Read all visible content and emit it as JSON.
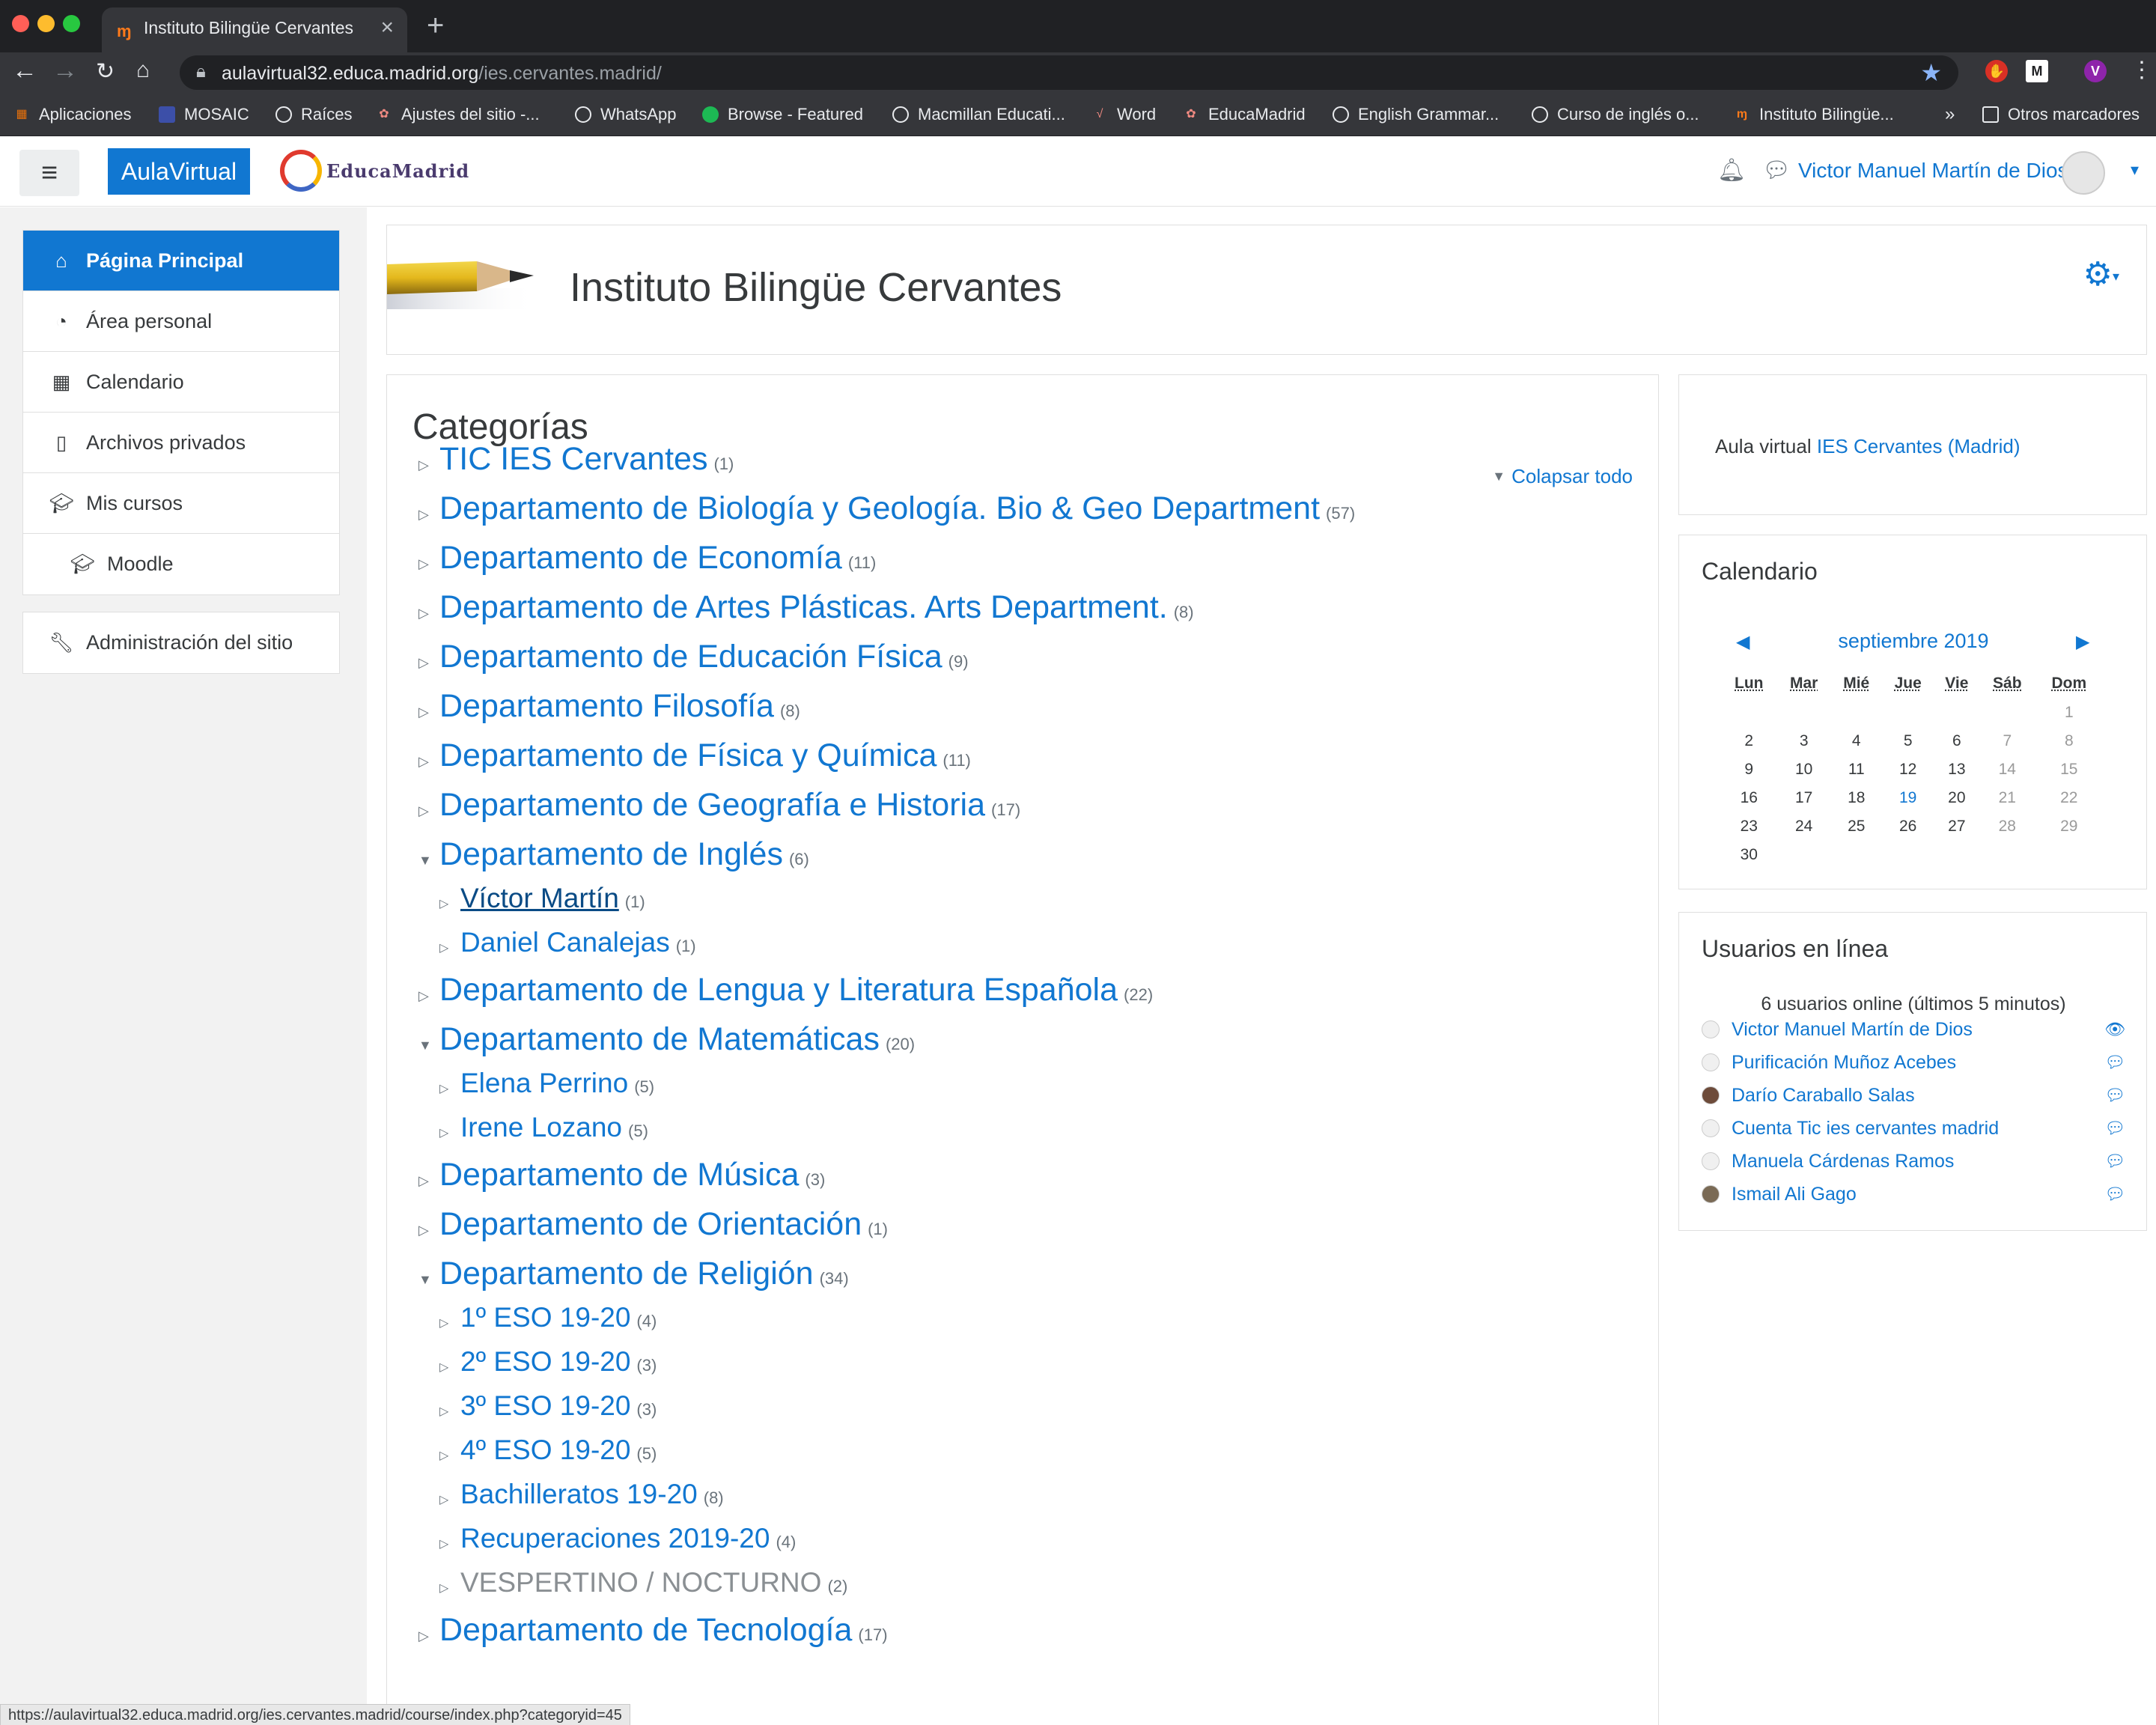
{
  "browser": {
    "tab_title": "Instituto Bilingüe Cervantes",
    "new_tab": "+",
    "url_host": "aulavirtual32.educa.madrid.org",
    "url_path": "/ies.cervantes.madrid/",
    "profile_initial": "V",
    "bookmarks": [
      "Aplicaciones",
      "MOSAIC",
      "Raíces",
      "Ajustes del sitio -...",
      "WhatsApp",
      "Browse - Featured",
      "Macmillan Educati...",
      "Word",
      "EducaMadrid",
      "English Grammar...",
      "Curso de inglés o...",
      "Instituto Bilingüe..."
    ],
    "bookmarks_more": "»",
    "other_bookmarks": "Otros marcadores",
    "status_url": "https://aulavirtual32.educa.madrid.org/ies.cervantes.madrid/course/index.php?categoryid=45"
  },
  "navbar": {
    "brand": "AulaVirtual",
    "logo_text": "EducaMadrid",
    "user_name": "Victor Manuel Martín de Dios"
  },
  "drawer": {
    "items": [
      {
        "label": "Página Principal",
        "icon": "home-icon"
      },
      {
        "label": "Área personal",
        "icon": "dashboard-icon"
      },
      {
        "label": "Calendario",
        "icon": "calendar-icon"
      },
      {
        "label": "Archivos privados",
        "icon": "file-icon"
      },
      {
        "label": "Mis cursos",
        "icon": "graduation-cap-icon"
      },
      {
        "label": "Moodle",
        "icon": "graduation-cap-icon"
      }
    ],
    "admin": {
      "label": "Administración del sitio",
      "icon": "wrench-icon"
    }
  },
  "header": {
    "title": "Instituto Bilingüe Cervantes"
  },
  "categories": {
    "heading": "Categorías",
    "collapse_all": "Colapsar todo",
    "rows": [
      {
        "name": "TIC IES Cervantes",
        "count": "(1)",
        "level": 1,
        "expanded": false
      },
      {
        "name": "Departamento de Biología y Geología. Bio & Geo Department",
        "count": "(57)",
        "level": 1,
        "expanded": false
      },
      {
        "name": "Departamento de Economía",
        "count": "(11)",
        "level": 1,
        "expanded": false
      },
      {
        "name": "Departamento de Artes Plásticas. Arts Department.",
        "count": "(8)",
        "level": 1,
        "expanded": false
      },
      {
        "name": "Departamento de Educación Física",
        "count": "(9)",
        "level": 1,
        "expanded": false
      },
      {
        "name": "Departamento Filosofía",
        "count": "(8)",
        "level": 1,
        "expanded": false
      },
      {
        "name": "Departamento de Física y Química",
        "count": "(11)",
        "level": 1,
        "expanded": false
      },
      {
        "name": "Departamento de Geografía e Historia",
        "count": "(17)",
        "level": 1,
        "expanded": false
      },
      {
        "name": "Departamento de Inglés",
        "count": "(6)",
        "level": 1,
        "expanded": true
      },
      {
        "name": "Víctor Martín",
        "count": "(1)",
        "level": 2,
        "expanded": false
      },
      {
        "name": "Daniel Canalejas",
        "count": "(1)",
        "level": 2,
        "expanded": false
      },
      {
        "name": "Departamento de Lengua y Literatura Española",
        "count": "(22)",
        "level": 1,
        "expanded": false
      },
      {
        "name": "Departamento de Matemáticas",
        "count": "(20)",
        "level": 1,
        "expanded": true
      },
      {
        "name": "Elena Perrino",
        "count": "(5)",
        "level": 2,
        "expanded": false
      },
      {
        "name": "Irene Lozano",
        "count": "(5)",
        "level": 2,
        "expanded": false
      },
      {
        "name": "Departamento de Música",
        "count": "(3)",
        "level": 1,
        "expanded": false
      },
      {
        "name": "Departamento de Orientación",
        "count": "(1)",
        "level": 1,
        "expanded": false
      },
      {
        "name": "Departamento de Religión",
        "count": "(34)",
        "level": 1,
        "expanded": true
      },
      {
        "name": "1º ESO 19-20",
        "count": "(4)",
        "level": 2,
        "expanded": false
      },
      {
        "name": "2º ESO 19-20",
        "count": "(3)",
        "level": 2,
        "expanded": false
      },
      {
        "name": "3º ESO 19-20",
        "count": "(3)",
        "level": 2,
        "expanded": false
      },
      {
        "name": "4º ESO 19-20",
        "count": "(5)",
        "level": 2,
        "expanded": false
      },
      {
        "name": "Bachilleratos 19-20",
        "count": "(8)",
        "level": 2,
        "expanded": false
      },
      {
        "name": "Recuperaciones 2019-20",
        "count": "(4)",
        "level": 2,
        "expanded": false
      },
      {
        "name": "VESPERTINO / NOCTURNO",
        "count": "(2)",
        "level": 2,
        "expanded": false,
        "hidden": true
      },
      {
        "name": "Departamento de Tecnología",
        "count": "(17)",
        "level": 1,
        "expanded": false
      }
    ]
  },
  "aula_block": {
    "prefix": "Aula virtual",
    "link": "IES Cervantes (Madrid)"
  },
  "calendar": {
    "title": "Calendario",
    "month": "septiembre 2019",
    "prev": "◀",
    "next": "▶",
    "weekdays": [
      "Lun",
      "Mar",
      "Mié",
      "Jue",
      "Vie",
      "Sáb",
      "Dom"
    ],
    "weeks": [
      [
        "",
        "",
        "",
        "",
        "",
        "",
        "1"
      ],
      [
        "2",
        "3",
        "4",
        "5",
        "6",
        "7",
        "8"
      ],
      [
        "9",
        "10",
        "11",
        "12",
        "13",
        "14",
        "15"
      ],
      [
        "16",
        "17",
        "18",
        "19",
        "20",
        "21",
        "22"
      ],
      [
        "23",
        "24",
        "25",
        "26",
        "27",
        "28",
        "29"
      ],
      [
        "30",
        "",
        "",
        "",
        "",
        "",
        ""
      ]
    ],
    "today": "19"
  },
  "online_users": {
    "title": "Usuarios en línea",
    "summary": "6 usuarios online (últimos 5 minutos)",
    "users": [
      {
        "name": "Victor Manuel Martín de Dios",
        "action_icon": "eye-icon"
      },
      {
        "name": "Purificación Muñoz Acebes",
        "action_icon": "message-icon"
      },
      {
        "name": "Darío Caraballo Salas",
        "action_icon": "message-icon"
      },
      {
        "name": "Cuenta Tic ies cervantes madrid",
        "action_icon": "message-icon"
      },
      {
        "name": "Manuela Cárdenas Ramos",
        "action_icon": "message-icon"
      },
      {
        "name": "Ismail Ali Gago",
        "action_icon": "message-icon"
      }
    ]
  },
  "colors": {
    "link": "#1177d1",
    "active_nav": "#1177d1",
    "text": "#373a3c",
    "muted": "#6a737b"
  }
}
